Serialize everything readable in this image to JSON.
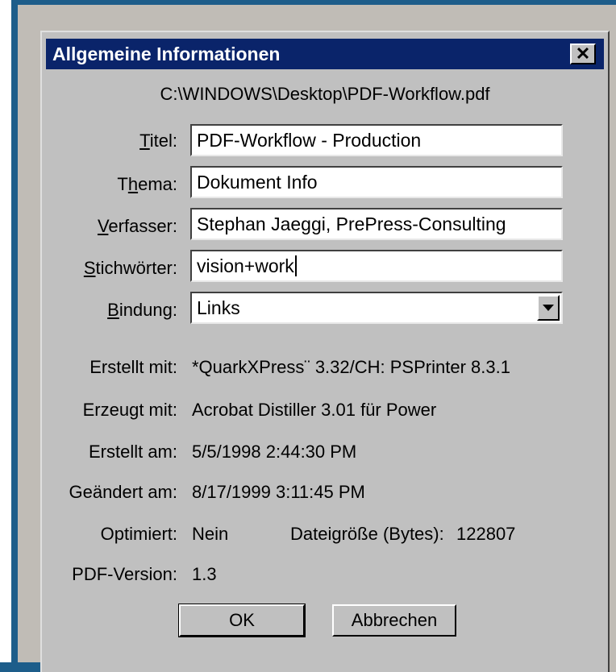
{
  "dialog": {
    "title": "Allgemeine Informationen",
    "close_symbol": "✕",
    "file_path": "C:\\WINDOWS\\Desktop\\PDF-Workflow.pdf"
  },
  "fields": {
    "titel": {
      "label_pre": "",
      "label_mnemonic": "T",
      "label_post": "itel:",
      "value": "PDF-Workflow - Production"
    },
    "thema": {
      "label_pre": "T",
      "label_mnemonic": "h",
      "label_post": "ema:",
      "value": "Dokument Info"
    },
    "verfasser": {
      "label_pre": "",
      "label_mnemonic": "V",
      "label_post": "erfasser:",
      "value": "Stephan Jaeggi, PrePress-Consulting"
    },
    "stichwoerter": {
      "label_pre": "",
      "label_mnemonic": "S",
      "label_post": "tichwörter:",
      "value": "vision+work"
    },
    "bindung": {
      "label_pre": "",
      "label_mnemonic": "B",
      "label_post": "indung:",
      "selected": "Links"
    }
  },
  "info": {
    "erstellt_mit": {
      "label": "Erstellt mit:",
      "value": "*QuarkXPress¨ 3.32/CH: PSPrinter 8.3.1"
    },
    "erzeugt_mit": {
      "label": "Erzeugt mit:",
      "value": "Acrobat Distiller 3.01 für Power"
    },
    "erstellt_am": {
      "label": "Erstellt am:",
      "value": "5/5/1998 2:44:30 PM"
    },
    "geaendert_am": {
      "label": "Geändert am:",
      "value": "8/17/1999 3:11:45 PM"
    },
    "optimiert": {
      "label": "Optimiert:",
      "value": "Nein"
    },
    "dateigroesse": {
      "label": "Dateigröße (Bytes):",
      "value": "122807"
    },
    "pdf_version": {
      "label": "PDF-Version:",
      "value": "1.3"
    }
  },
  "buttons": {
    "ok": "OK",
    "cancel": "Abbrechen"
  },
  "colors": {
    "titlebar": "#0a246a",
    "dialog_bg": "#c0c0c0",
    "frame": "#1d5d8a"
  }
}
